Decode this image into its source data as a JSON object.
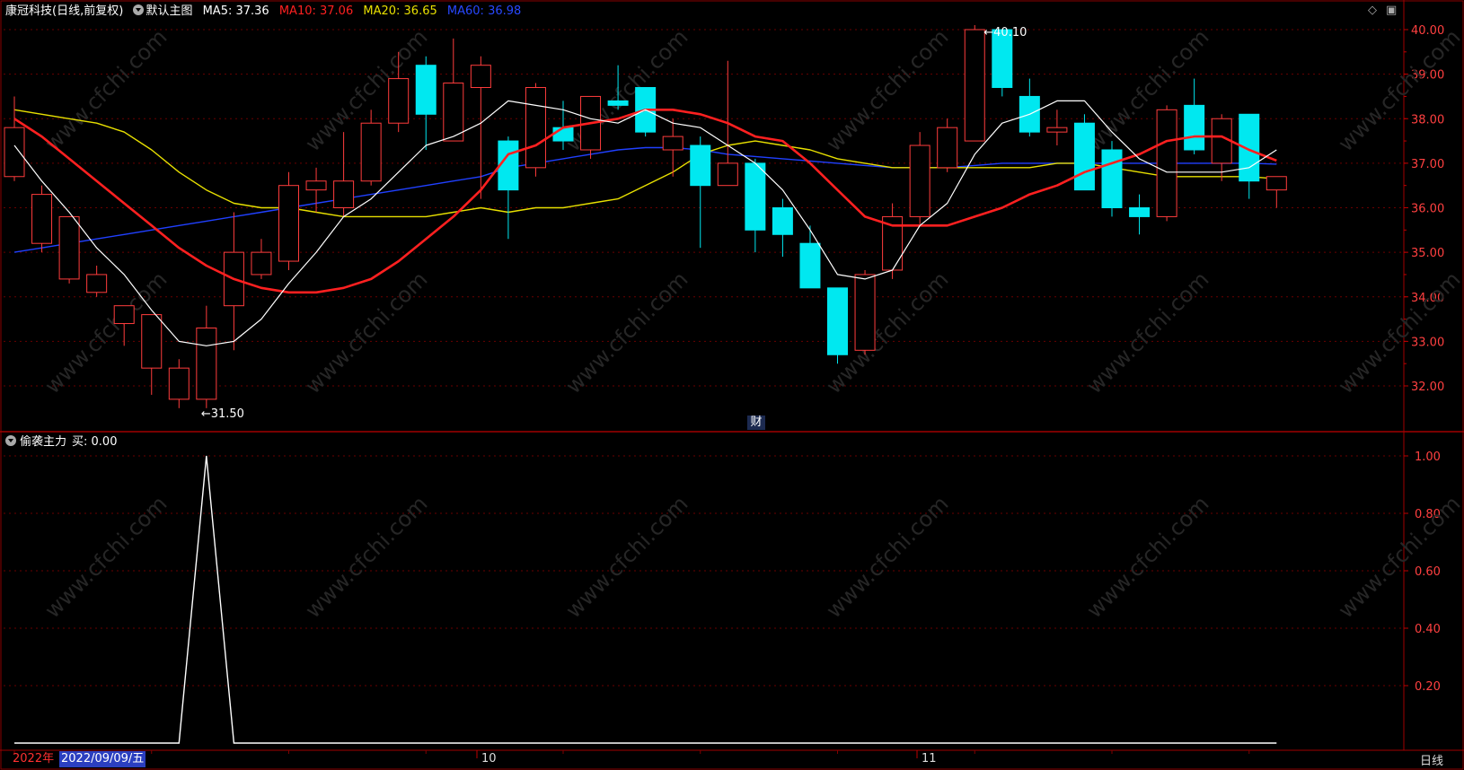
{
  "header": {
    "stock_name": "康冠科技",
    "period": "(日线,前复权)",
    "main_chart": "默认主图",
    "ma5_label": "MA5: 37.36",
    "ma10_label": "MA10: 37.06",
    "ma20_label": "MA20: 36.65",
    "ma60_label": "MA60: 36.98",
    "ma5_color": "#ffffff",
    "ma10_color": "#ff2020",
    "ma20_color": "#e8e000",
    "ma60_color": "#2040ff"
  },
  "indicator": {
    "name": "偷袭主力",
    "value_label": "买: 0.00"
  },
  "price_axis": [
    "40.00",
    "39.00",
    "38.00",
    "37.00",
    "36.00",
    "35.00",
    "34.00",
    "33.00",
    "32.00"
  ],
  "indicator_axis": [
    "1.00",
    "0.80",
    "0.60",
    "0.40",
    "0.20"
  ],
  "annotations": {
    "high_label": "40.10",
    "low_label": "31.50",
    "cai_badge": "财"
  },
  "footer": {
    "year": "2022年",
    "date": "2022/09/09/五",
    "month_10": "10",
    "month_11": "11",
    "period_label": "日线"
  },
  "watermark": "www.cfchi.com",
  "chart_data": {
    "type": "candlestick",
    "price_range": [
      31.5,
      40.4
    ],
    "candles": [
      {
        "o": 36.7,
        "h": 38.5,
        "l": 36.6,
        "c": 37.8
      },
      {
        "o": 35.2,
        "h": 36.5,
        "l": 35.0,
        "c": 36.3
      },
      {
        "o": 34.4,
        "h": 35.8,
        "l": 34.3,
        "c": 35.8
      },
      {
        "o": 34.1,
        "h": 34.7,
        "l": 34.0,
        "c": 34.5
      },
      {
        "o": 33.4,
        "h": 33.8,
        "l": 32.9,
        "c": 33.8
      },
      {
        "o": 32.4,
        "h": 33.6,
        "l": 31.8,
        "c": 33.6
      },
      {
        "o": 31.7,
        "h": 32.6,
        "l": 31.5,
        "c": 32.4
      },
      {
        "o": 31.7,
        "h": 33.8,
        "l": 31.5,
        "c": 33.3
      },
      {
        "o": 33.8,
        "h": 35.9,
        "l": 32.8,
        "c": 35.0
      },
      {
        "o": 34.5,
        "h": 35.3,
        "l": 34.4,
        "c": 35.0
      },
      {
        "o": 34.8,
        "h": 36.8,
        "l": 34.6,
        "c": 36.5
      },
      {
        "o": 36.4,
        "h": 36.9,
        "l": 35.9,
        "c": 36.6
      },
      {
        "o": 36.0,
        "h": 37.7,
        "l": 35.8,
        "c": 36.6
      },
      {
        "o": 36.6,
        "h": 38.2,
        "l": 36.5,
        "c": 37.9
      },
      {
        "o": 37.9,
        "h": 39.5,
        "l": 37.7,
        "c": 38.9
      },
      {
        "o": 39.2,
        "h": 39.4,
        "l": 37.3,
        "c": 38.1
      },
      {
        "o": 37.5,
        "h": 39.8,
        "l": 37.5,
        "c": 38.8
      },
      {
        "o": 38.7,
        "h": 39.4,
        "l": 36.2,
        "c": 39.2
      },
      {
        "o": 37.5,
        "h": 37.6,
        "l": 35.3,
        "c": 36.4
      },
      {
        "o": 36.9,
        "h": 38.8,
        "l": 36.7,
        "c": 38.7
      },
      {
        "o": 37.8,
        "h": 38.4,
        "l": 37.3,
        "c": 37.5
      },
      {
        "o": 37.3,
        "h": 38.5,
        "l": 37.1,
        "c": 38.5
      },
      {
        "o": 38.4,
        "h": 39.2,
        "l": 38.2,
        "c": 38.3
      },
      {
        "o": 38.7,
        "h": 38.7,
        "l": 37.6,
        "c": 37.7
      },
      {
        "o": 37.3,
        "h": 38.0,
        "l": 36.7,
        "c": 37.6
      },
      {
        "o": 37.4,
        "h": 37.6,
        "l": 35.1,
        "c": 36.5
      },
      {
        "o": 36.5,
        "h": 39.3,
        "l": 36.5,
        "c": 37.0
      },
      {
        "o": 37.0,
        "h": 37.1,
        "l": 35.0,
        "c": 35.5
      },
      {
        "o": 36.0,
        "h": 36.2,
        "l": 34.9,
        "c": 35.4
      },
      {
        "o": 35.2,
        "h": 35.6,
        "l": 34.2,
        "c": 34.2
      },
      {
        "o": 34.2,
        "h": 34.2,
        "l": 32.5,
        "c": 32.7
      },
      {
        "o": 32.8,
        "h": 34.6,
        "l": 32.7,
        "c": 34.5
      },
      {
        "o": 34.6,
        "h": 36.1,
        "l": 34.4,
        "c": 35.8
      },
      {
        "o": 35.8,
        "h": 37.7,
        "l": 35.6,
        "c": 37.4
      },
      {
        "o": 36.9,
        "h": 38.0,
        "l": 36.8,
        "c": 37.8
      },
      {
        "o": 37.5,
        "h": 40.1,
        "l": 37.5,
        "c": 40.0
      },
      {
        "o": 40.0,
        "h": 40.0,
        "l": 38.5,
        "c": 38.7
      },
      {
        "o": 38.5,
        "h": 38.9,
        "l": 37.6,
        "c": 37.7
      },
      {
        "o": 37.7,
        "h": 38.2,
        "l": 37.4,
        "c": 37.8
      },
      {
        "o": 37.9,
        "h": 38.1,
        "l": 36.4,
        "c": 36.4
      },
      {
        "o": 37.3,
        "h": 37.5,
        "l": 35.8,
        "c": 36.0
      },
      {
        "o": 36.0,
        "h": 36.3,
        "l": 35.4,
        "c": 35.8
      },
      {
        "o": 35.8,
        "h": 38.3,
        "l": 35.7,
        "c": 38.2
      },
      {
        "o": 38.3,
        "h": 38.9,
        "l": 37.2,
        "c": 37.3
      },
      {
        "o": 37.0,
        "h": 38.1,
        "l": 36.6,
        "c": 38.0
      },
      {
        "o": 38.1,
        "h": 38.1,
        "l": 36.2,
        "c": 36.6
      },
      {
        "o": 36.4,
        "h": 36.7,
        "l": 36.0,
        "c": 36.7
      }
    ],
    "ma5": [
      37.4,
      36.6,
      35.9,
      35.1,
      34.5,
      33.7,
      33.0,
      32.9,
      33.0,
      33.5,
      34.3,
      35.0,
      35.8,
      36.2,
      36.8,
      37.4,
      37.6,
      37.9,
      38.4,
      38.3,
      38.2,
      38.0,
      37.9,
      38.2,
      37.9,
      37.8,
      37.4,
      37.0,
      36.4,
      35.5,
      34.5,
      34.4,
      34.6,
      35.6,
      36.1,
      37.2,
      37.9,
      38.1,
      38.4,
      38.4,
      37.7,
      37.1,
      36.8,
      36.8,
      36.8,
      36.9,
      37.3
    ],
    "ma10": [
      38.0,
      37.6,
      37.1,
      36.6,
      36.1,
      35.6,
      35.1,
      34.7,
      34.4,
      34.2,
      34.1,
      34.1,
      34.2,
      34.4,
      34.8,
      35.3,
      35.8,
      36.4,
      37.2,
      37.4,
      37.8,
      37.9,
      38.0,
      38.2,
      38.2,
      38.1,
      37.9,
      37.6,
      37.5,
      37.0,
      36.4,
      35.8,
      35.6,
      35.6,
      35.6,
      35.8,
      36.0,
      36.3,
      36.5,
      36.8,
      37.0,
      37.2,
      37.5,
      37.6,
      37.6,
      37.3,
      37.06
    ],
    "ma20": [
      38.2,
      38.1,
      38.0,
      37.9,
      37.7,
      37.3,
      36.8,
      36.4,
      36.1,
      36.0,
      36.0,
      35.9,
      35.8,
      35.8,
      35.8,
      35.8,
      35.9,
      36.0,
      35.9,
      36.0,
      36.0,
      36.1,
      36.2,
      36.5,
      36.8,
      37.2,
      37.4,
      37.5,
      37.4,
      37.3,
      37.1,
      37.0,
      36.9,
      36.9,
      36.9,
      36.9,
      36.9,
      36.9,
      37.0,
      37.0,
      36.9,
      36.8,
      36.7,
      36.7,
      36.7,
      36.7,
      36.65
    ],
    "ma60": [
      35.0,
      35.1,
      35.2,
      35.3,
      35.4,
      35.5,
      35.6,
      35.7,
      35.8,
      35.9,
      36.0,
      36.1,
      36.2,
      36.3,
      36.4,
      36.5,
      36.6,
      36.7,
      36.9,
      37.0,
      37.1,
      37.2,
      37.3,
      37.35,
      37.35,
      37.3,
      37.2,
      37.15,
      37.1,
      37.05,
      37.0,
      36.95,
      36.9,
      36.9,
      36.9,
      36.95,
      37.0,
      37.0,
      37.0,
      37.0,
      37.0,
      37.0,
      37.0,
      37.0,
      37.0,
      37.0,
      36.98
    ],
    "indicator_values": [
      0,
      0,
      0,
      0,
      0,
      0,
      0,
      1,
      0,
      0,
      0,
      0,
      0,
      0,
      0,
      0,
      0,
      0,
      0,
      0,
      0,
      0,
      0,
      0,
      0,
      0,
      0,
      0,
      0,
      0,
      0,
      0,
      0,
      0,
      0,
      0,
      0,
      0,
      0,
      0,
      0,
      0,
      0,
      0,
      0,
      0,
      0
    ],
    "indicator_range": [
      0,
      1.0
    ]
  }
}
